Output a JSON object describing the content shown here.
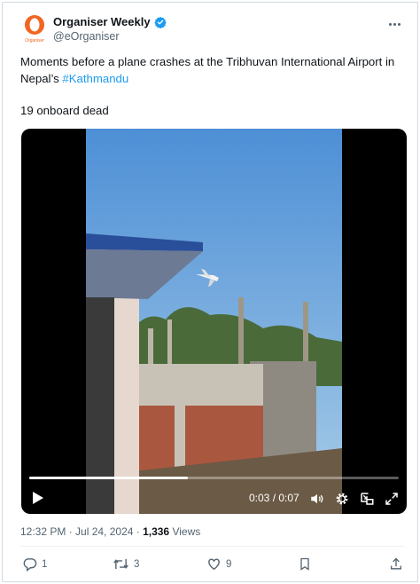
{
  "account": {
    "name": "Organiser Weekly",
    "handle": "@eOrganiser",
    "logo_text": "Organiser"
  },
  "tweet": {
    "text_part1": "Moments before a plane crashes at the Tribhuvan International Airport in Nepal’s ",
    "hashtag": "#Kathmandu",
    "text_line2": "19 onboard dead"
  },
  "video": {
    "time_label": "0:03 / 0:07",
    "progress_fraction": 0.43
  },
  "meta": {
    "time": "12:32 PM · Jul 24, 2024 · ",
    "views_count": "1,336",
    "views_label": " Views"
  },
  "actions": {
    "reply_count": "1",
    "repost_count": "3",
    "like_count": "9"
  },
  "colors": {
    "accent": "#1d9bf0",
    "logo_orange": "#f26522",
    "text_secondary": "#536471"
  },
  "icons": [
    "verified-icon",
    "more-icon",
    "play-icon",
    "volume-icon",
    "settings-icon",
    "picture-in-picture-icon",
    "fullscreen-icon",
    "reply-icon",
    "repost-icon",
    "like-icon",
    "bookmark-icon",
    "share-icon"
  ]
}
